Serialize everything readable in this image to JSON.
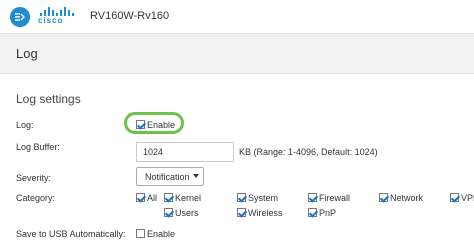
{
  "header": {
    "logo_text": "cisco",
    "device_name": "RV160W-Rv160"
  },
  "page": {
    "title": "Log"
  },
  "section": {
    "title": "Log settings"
  },
  "log": {
    "label": "Log:",
    "enable_label": "Enable",
    "enabled": true
  },
  "buffer": {
    "label": "Log Buffer:",
    "value": "1024",
    "hint": "KB (Range: 1-4096, Default: 1024)"
  },
  "severity": {
    "label": "Severity:",
    "selected": "Notification"
  },
  "category": {
    "label": "Category:",
    "items": [
      {
        "label": "All",
        "checked": true
      },
      {
        "label": "Kernel",
        "checked": true
      },
      {
        "label": "System",
        "checked": true
      },
      {
        "label": "Firewall",
        "checked": true
      },
      {
        "label": "Network",
        "checked": true
      },
      {
        "label": "VPN",
        "checked": true
      },
      {
        "label": "Users",
        "checked": true
      },
      {
        "label": "Wireless",
        "checked": true
      },
      {
        "label": "PnP",
        "checked": true
      }
    ]
  },
  "usb": {
    "label": "Save to USB Automatically:",
    "enable_label": "Enable",
    "checked": false
  },
  "colors": {
    "accent": "#1f8bd0",
    "highlight": "#6cc24a",
    "header_bg": "#f2f2f2"
  }
}
